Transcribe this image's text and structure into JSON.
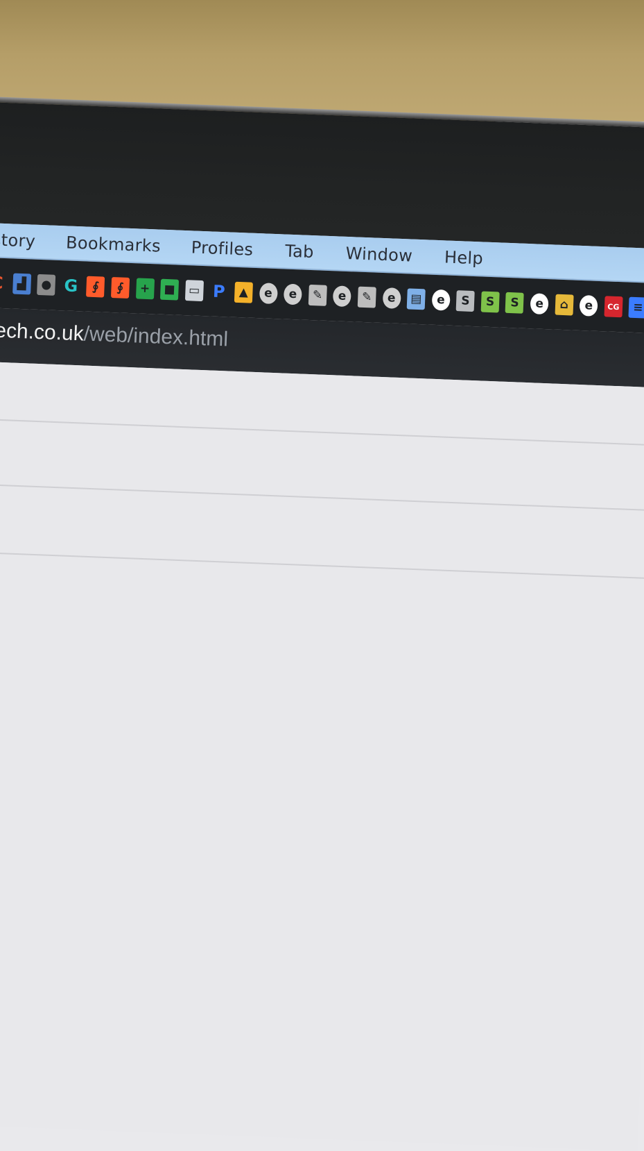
{
  "menubar": {
    "items": [
      "story",
      "Bookmarks",
      "Profiles",
      "Tab",
      "Window",
      "Help"
    ]
  },
  "address_bar": {
    "host": "tech.co.uk",
    "path": "/web/index.html"
  },
  "bookmarks": [
    {
      "icon": "c-logo-icon",
      "color": "#e6552f"
    },
    {
      "icon": "chart-icon",
      "color": "#4a7fd0"
    },
    {
      "icon": "apple-icon",
      "color": "#8c8c8c"
    },
    {
      "icon": "g-logo-icon",
      "color": "#29c3c6"
    },
    {
      "icon": "orange-swirl-icon",
      "color": "#ff5b2b"
    },
    {
      "icon": "orange-swirl-icon",
      "color": "#ff5b2b"
    },
    {
      "icon": "green-plus-icon",
      "color": "#27a34c"
    },
    {
      "icon": "green-square-icon",
      "color": "#2fae52"
    },
    {
      "icon": "screen-icon",
      "color": "#cfd4da"
    },
    {
      "icon": "blue-p-icon",
      "color": "#3b7cff"
    },
    {
      "icon": "firebase-icon",
      "color": "#f4b12a"
    },
    {
      "icon": "e-circle-icon",
      "color": "#cfcfcf"
    },
    {
      "icon": "e-circle-icon",
      "color": "#cfcfcf"
    },
    {
      "icon": "page-icon",
      "color": "#bdbdbd"
    },
    {
      "icon": "e-circle-icon",
      "color": "#cfcfcf"
    },
    {
      "icon": "page-icon",
      "color": "#bdbdbd"
    },
    {
      "icon": "e-circle-icon",
      "color": "#cfcfcf"
    },
    {
      "icon": "folder-icon",
      "color": "#7fb0e8"
    },
    {
      "icon": "e-circle-icon",
      "color": "#ffffff"
    },
    {
      "icon": "shopify-bag-icon",
      "color": "#b9bcbf"
    },
    {
      "icon": "shopify-bag-icon",
      "color": "#7fc24a"
    },
    {
      "icon": "shopify-bag-icon",
      "color": "#7fc24a"
    },
    {
      "icon": "e-circle-icon",
      "color": "#ffffff"
    },
    {
      "icon": "padlock-icon",
      "color": "#e6b93a"
    },
    {
      "icon": "e-circle-icon",
      "color": "#ffffff"
    },
    {
      "icon": "cg-logo-icon",
      "color": "#d6262e"
    },
    {
      "icon": "list-icon",
      "color": "#3b7cff"
    }
  ]
}
